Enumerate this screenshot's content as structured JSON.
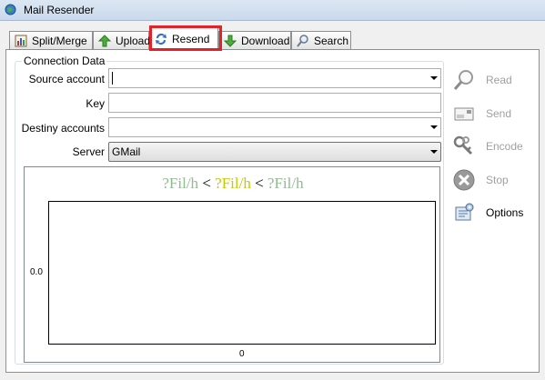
{
  "window": {
    "title": "Mail Resender"
  },
  "tabs": [
    {
      "label": "Split/Merge"
    },
    {
      "label": "Upload"
    },
    {
      "label": "Resend"
    },
    {
      "label": "Download"
    },
    {
      "label": "Search"
    }
  ],
  "connection": {
    "group_title": "Connection Data",
    "source_label": "Source account",
    "source_value": "",
    "key_label": "Key",
    "key_value": "",
    "destiny_label": "Destiny accounts",
    "destiny_value": "",
    "server_label": "Server",
    "server_value": "GMail"
  },
  "chart_data": {
    "type": "line",
    "title_parts": [
      "?Fil/h",
      " < ",
      "?Fil/h",
      " < ",
      "?Fil/h"
    ],
    "title_colors": [
      "#8fbc8f",
      "#000000",
      "#c8c800",
      "#000000",
      "#8fbc8f"
    ],
    "ytick_labels": [
      "0.0"
    ],
    "xtick_labels": [
      "0"
    ],
    "series": []
  },
  "actions": [
    {
      "label": "Read",
      "enabled": false,
      "icon": "magnifier-icon"
    },
    {
      "label": "Send",
      "enabled": false,
      "icon": "envelope-icon"
    },
    {
      "label": "Encode",
      "enabled": false,
      "icon": "keys-icon"
    },
    {
      "label": "Stop",
      "enabled": false,
      "icon": "stop-icon"
    },
    {
      "label": "Options",
      "enabled": true,
      "icon": "options-icon"
    }
  ]
}
